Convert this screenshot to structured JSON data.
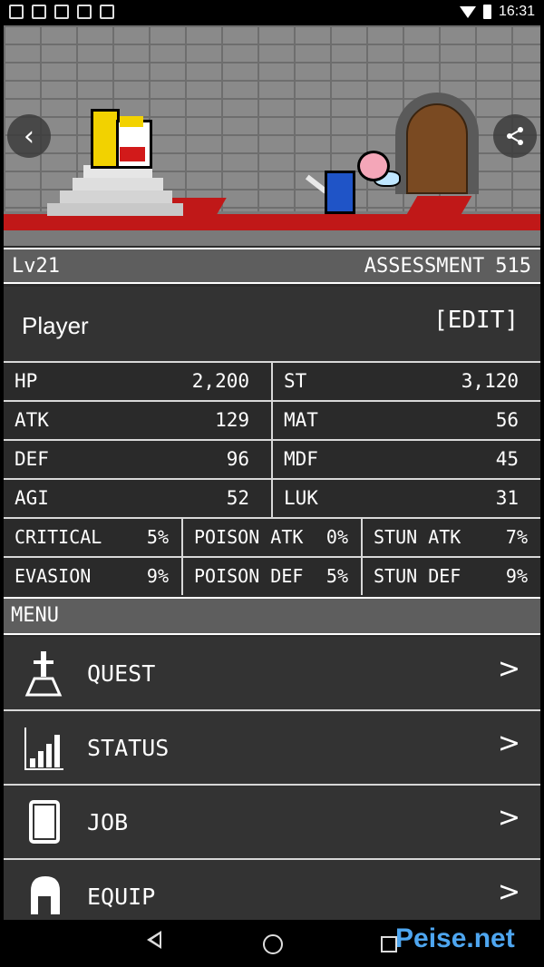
{
  "statusbar": {
    "time": "16:31"
  },
  "header": {
    "level": "Lv21",
    "assessment_label": "ASSESSMENT",
    "assessment_value": "515"
  },
  "player": {
    "name": "Player",
    "edit_label": "[EDIT]"
  },
  "stats": [
    [
      {
        "label": "HP",
        "value": "2,200"
      },
      {
        "label": "ST",
        "value": "3,120"
      }
    ],
    [
      {
        "label": "ATK",
        "value": "129"
      },
      {
        "label": "MAT",
        "value": "56"
      }
    ],
    [
      {
        "label": "DEF",
        "value": "96"
      },
      {
        "label": "MDF",
        "value": "45"
      }
    ],
    [
      {
        "label": "AGI",
        "value": "52"
      },
      {
        "label": "LUK",
        "value": "31"
      }
    ]
  ],
  "substats": [
    [
      {
        "label": "CRITICAL",
        "value": "5%"
      },
      {
        "label": "POISON ATK",
        "value": "0%"
      },
      {
        "label": "STUN ATK",
        "value": "7%"
      }
    ],
    [
      {
        "label": "EVASION",
        "value": "9%"
      },
      {
        "label": "POISON DEF",
        "value": "5%"
      },
      {
        "label": "STUN DEF",
        "value": "9%"
      }
    ]
  ],
  "menu": {
    "title": "MENU",
    "items": [
      {
        "label": "QUEST",
        "icon": "sword-in-stone-icon"
      },
      {
        "label": "STATUS",
        "icon": "bar-chart-icon"
      },
      {
        "label": "JOB",
        "icon": "book-icon"
      },
      {
        "label": "EQUIP",
        "icon": "helmet-icon"
      }
    ]
  },
  "watermark": "Peise.net"
}
